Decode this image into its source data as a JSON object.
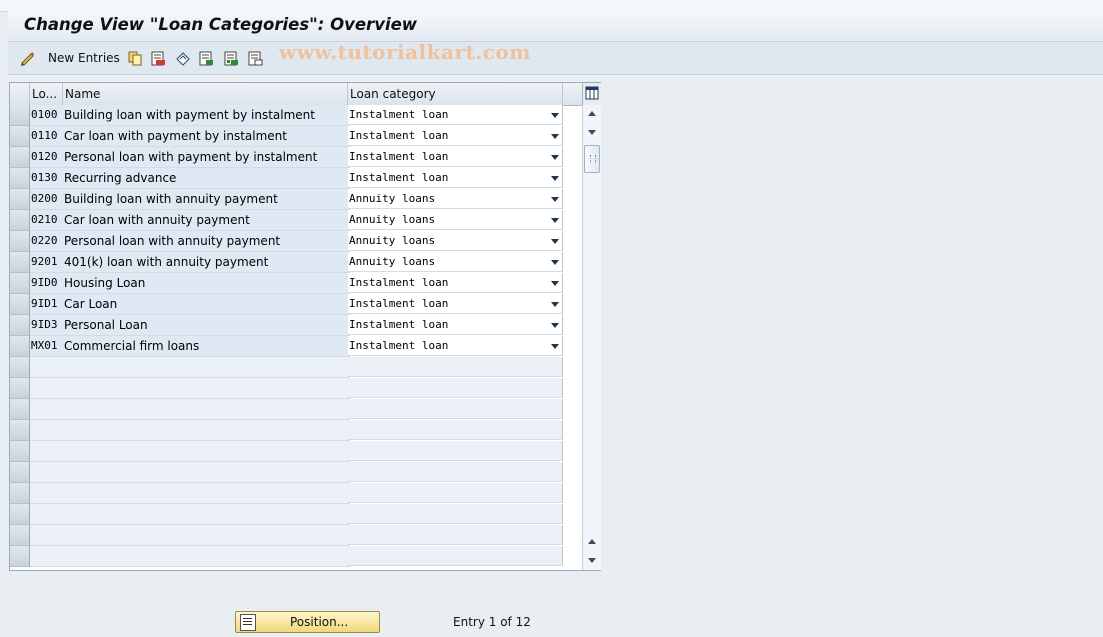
{
  "window": {
    "title": "Change View \"Loan Categories\": Overview"
  },
  "toolbar": {
    "new_entries_label": "New Entries",
    "icons": [
      "edit-pencil-icon",
      "copy-icon",
      "delete-icon",
      "undo-icon",
      "select-all-icon",
      "select-block-icon",
      "deselect-all-icon"
    ]
  },
  "watermark": "www.tutorialkart.com",
  "table": {
    "columns": [
      "Lo...",
      "Name",
      "Loan category"
    ],
    "rows": [
      {
        "code": "0100",
        "name": "Building loan with payment by instalment",
        "category": "Instalment loan"
      },
      {
        "code": "0110",
        "name": "Car loan with payment by instalment",
        "category": "Instalment loan"
      },
      {
        "code": "0120",
        "name": "Personal loan with payment by instalment",
        "category": "Instalment loan"
      },
      {
        "code": "0130",
        "name": "Recurring advance",
        "category": "Instalment loan"
      },
      {
        "code": "0200",
        "name": "Building loan with annuity payment",
        "category": "Annuity loans"
      },
      {
        "code": "0210",
        "name": "Car loan with annuity payment",
        "category": "Annuity loans"
      },
      {
        "code": "0220",
        "name": "Personal loan with annuity payment",
        "category": "Annuity loans"
      },
      {
        "code": "9201",
        "name": "401(k) loan with annuity payment",
        "category": "Annuity loans"
      },
      {
        "code": "9ID0",
        "name": "Housing Loan",
        "category": "Instalment loan"
      },
      {
        "code": "9ID1",
        "name": "Car Loan",
        "category": "Instalment loan"
      },
      {
        "code": "9ID3",
        "name": "Personal Loan",
        "category": "Instalment loan"
      },
      {
        "code": "MX01",
        "name": "Commercial firm loans",
        "category": "Instalment loan"
      }
    ]
  },
  "footer": {
    "position_button_label": "Position...",
    "entry_text": "Entry 1 of 12"
  },
  "colors": {
    "accent_button": "#f2d77b",
    "row_fill": "#dfe9f3",
    "background": "#e9eef3"
  }
}
